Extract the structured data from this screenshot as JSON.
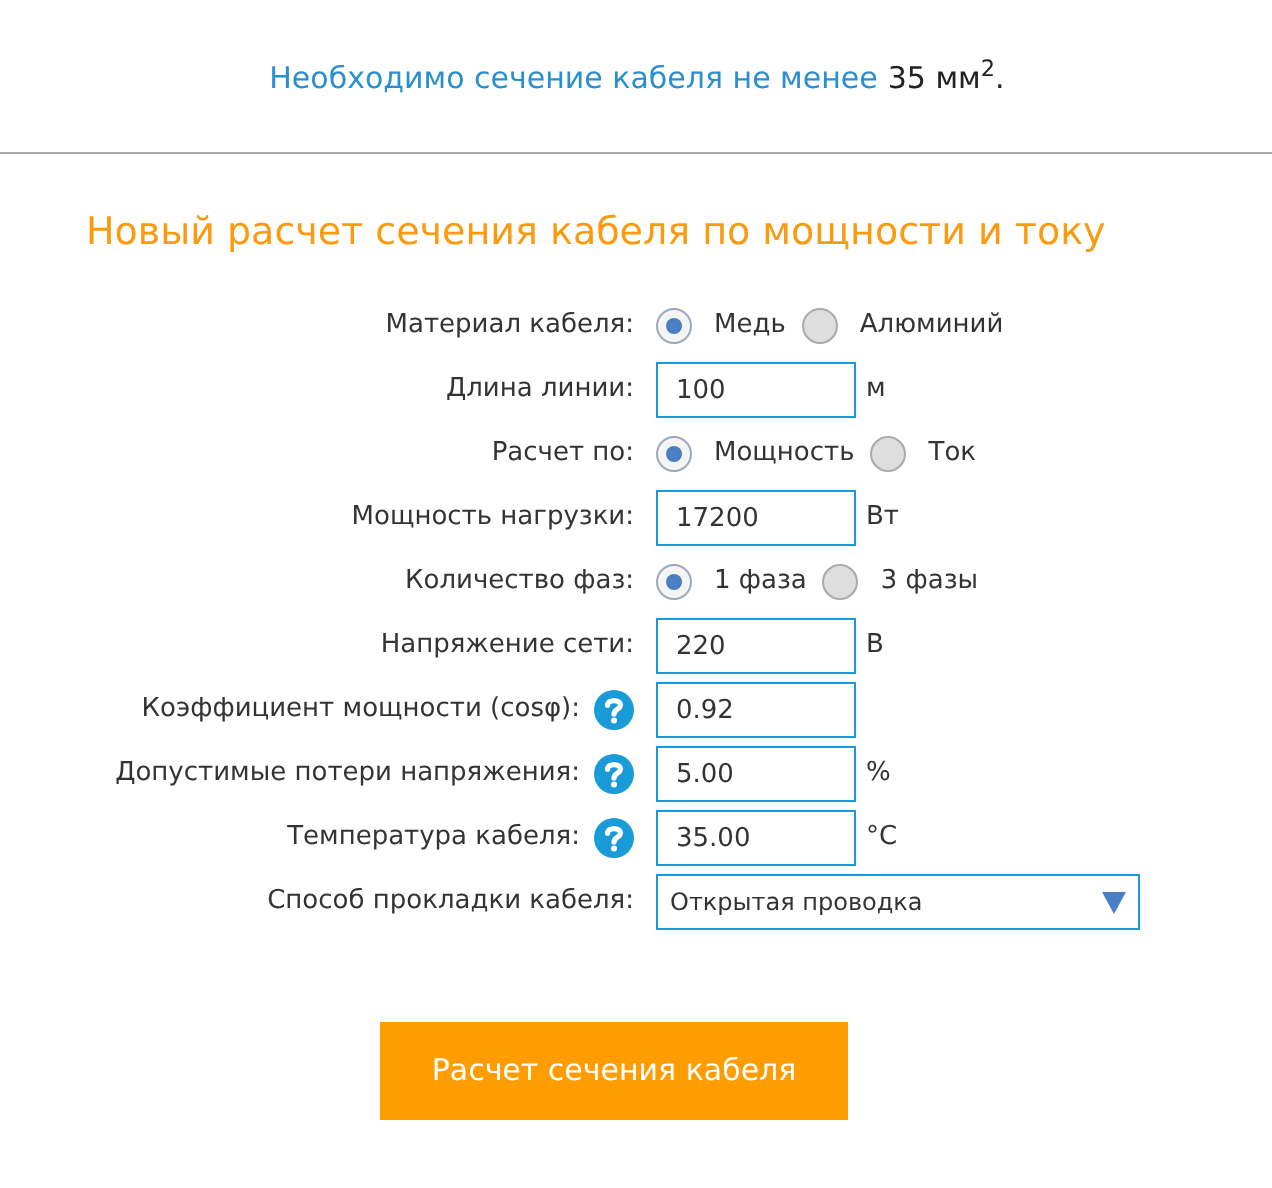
{
  "result": {
    "text": "Необходимо сечение кабеля не менее",
    "value": "35 мм$^{2}$."
  },
  "heading": "Новый расчет сечения кабеля по мощности и току",
  "fields": [
    {
      "kind": "radio",
      "label": "Материал кабеля:",
      "help": false,
      "options": [
        {
          "label": "Медь",
          "selected": true
        },
        {
          "label": "Алюминий",
          "selected": false
        }
      ]
    },
    {
      "kind": "input",
      "label": "Длина линии:",
      "help": false,
      "value": "100",
      "unit": "м"
    },
    {
      "kind": "radio",
      "label": "Расчет по:",
      "help": false,
      "options": [
        {
          "label": "Мощность",
          "selected": true
        },
        {
          "label": "Ток",
          "selected": false
        }
      ]
    },
    {
      "kind": "input",
      "label": "Мощность нагрузки:",
      "help": false,
      "value": "17200",
      "unit": "Вт"
    },
    {
      "kind": "radio",
      "label": "Количество фаз:",
      "help": false,
      "options": [
        {
          "label": "1 фаза",
          "selected": true
        },
        {
          "label": "3 фазы",
          "selected": false
        }
      ]
    },
    {
      "kind": "input",
      "label": "Напряжение сети:",
      "help": false,
      "value": "220",
      "unit": "В"
    },
    {
      "kind": "input",
      "label": "Коэффициент мощности (cosφ):",
      "help": true,
      "value": "0.92"
    },
    {
      "kind": "input",
      "label": "Допустимые потери напряжения:",
      "help": true,
      "value": "5.00",
      "unit": "%"
    },
    {
      "kind": "input",
      "label": "Температура кабеля:",
      "help": true,
      "value": "35.00",
      "unit": "°C"
    },
    {
      "kind": "select",
      "label": "Способ прокладки кабеля:",
      "help": false,
      "value": "Открытая проводка"
    }
  ],
  "button": "Расчет сечения кабеля"
}
